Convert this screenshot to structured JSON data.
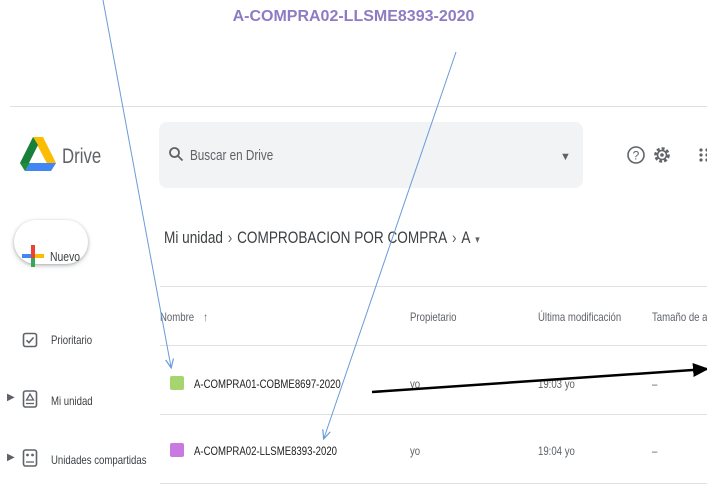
{
  "annotation": {
    "title": "A-COMPRA02-LLSME8393-2020"
  },
  "app": {
    "name": "Drive"
  },
  "search": {
    "placeholder": "Buscar en Drive"
  },
  "new_button": {
    "label": "Nuevo"
  },
  "sidebar": {
    "items": [
      {
        "label": "Prioritario",
        "icon": "check-box-icon"
      },
      {
        "label": "Mi unidad",
        "icon": "drive-icon"
      },
      {
        "label": "Unidades compartidas",
        "icon": "shared-drive-icon"
      }
    ]
  },
  "breadcrumb": {
    "items": [
      "Mi unidad",
      "COMPROBACION POR COMPRA",
      "A"
    ]
  },
  "table": {
    "headers": {
      "name": "Nombre",
      "owner": "Propietario",
      "modified": "Última modificación",
      "size": "Tamaño de arch"
    },
    "rows": [
      {
        "name": "A-COMPRA01-COBME8697-2020",
        "owner": "yo",
        "modified": "19:03 yo",
        "size": "–",
        "color": "#a6d46f"
      },
      {
        "name": "A-COMPRA02-LLSME8393-2020",
        "owner": "yo",
        "modified": "19:04 yo",
        "size": "–",
        "color": "#c97ae0"
      }
    ]
  },
  "colors": {
    "annotation_line": "#6a9bd8",
    "arrow": "#000000",
    "annotation_title": "#8e7cc3"
  }
}
